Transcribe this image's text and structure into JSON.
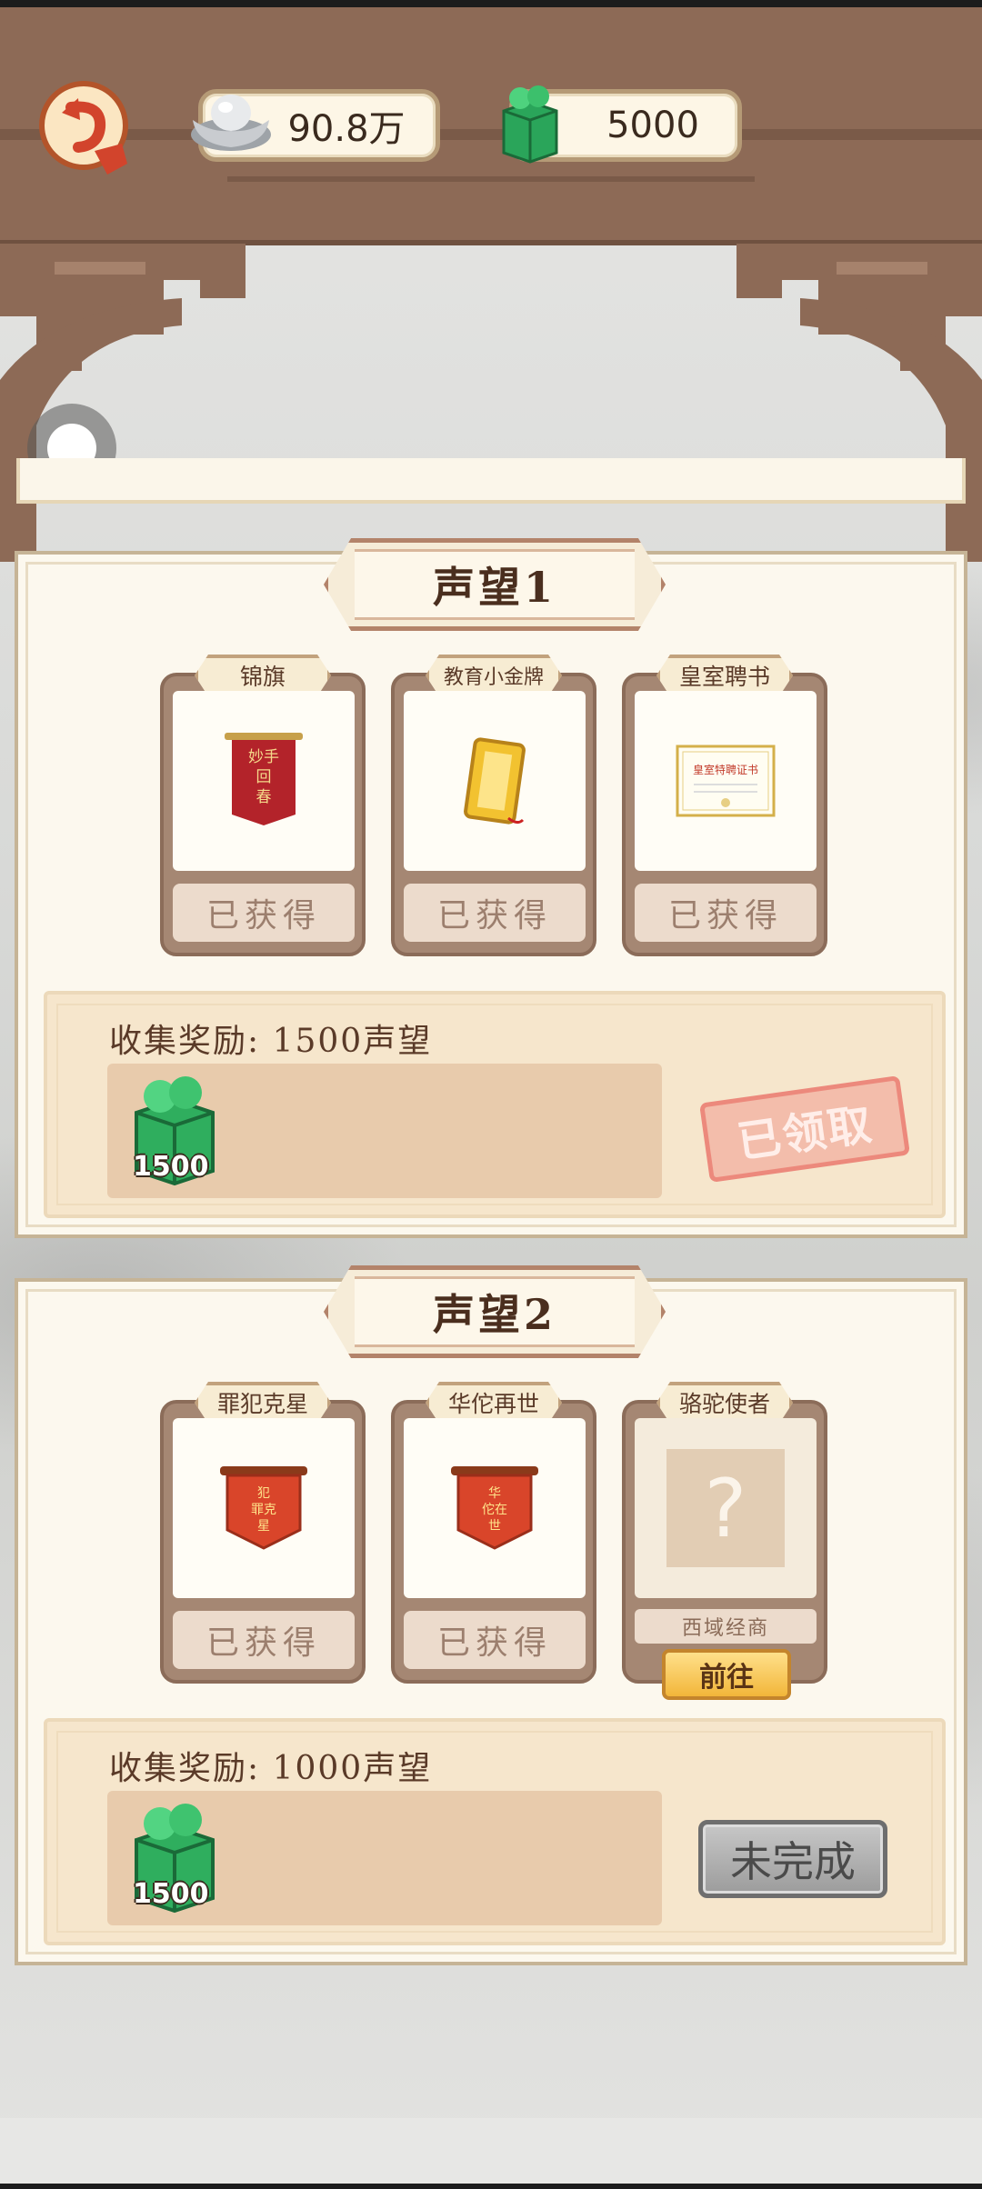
{
  "header": {
    "back_icon": "return-arrow-icon",
    "silver_icon": "silver-ingot-icon",
    "silver_amount": "90.8万",
    "jade_icon": "jade-block-icon",
    "jade_amount": "5000"
  },
  "sections": [
    {
      "title": "声望1",
      "items": [
        {
          "tag": "锦旗",
          "status": "已获得",
          "banner_text": "妙手回春"
        },
        {
          "tag": "教育小金牌",
          "status": "已获得"
        },
        {
          "tag": "皇室聘书",
          "status": "已获得",
          "doc_text": "皇室特聘证书"
        }
      ],
      "reward_label": "收集奖励: 1500声望",
      "reward_count": "1500",
      "reward_state": "已领取"
    },
    {
      "title": "声望2",
      "items": [
        {
          "tag": "罪犯克星",
          "status": "已获得",
          "banner_text": "犯罪克星"
        },
        {
          "tag": "华佗再世",
          "status": "已获得",
          "banner_text": "华佗在世"
        },
        {
          "tag": "骆驼使者",
          "hint": "西域经商",
          "unknown": "?",
          "action": "前往"
        }
      ],
      "reward_label": "收集奖励: 1000声望",
      "reward_count": "1500",
      "reward_state": "未完成"
    }
  ]
}
